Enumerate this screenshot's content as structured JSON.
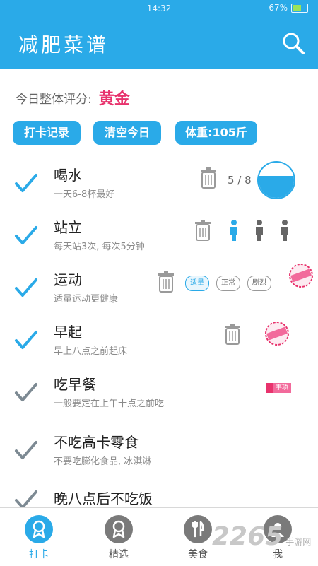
{
  "status_bar": {
    "time": "14:32",
    "battery": "67%",
    "battery_level": 0.67
  },
  "header": {
    "title": "减肥菜谱",
    "search_icon": "search-icon"
  },
  "score": {
    "label": "今日整体评分:",
    "value": "黄金"
  },
  "actions": [
    {
      "label": "打卡记录"
    },
    {
      "label": "清空今日"
    },
    {
      "label": "体重:105斤"
    }
  ],
  "items": [
    {
      "title": "喝水",
      "subtitle": "一天6-8杯最好",
      "count": "5 / 8",
      "water_level": 0.625
    },
    {
      "title": "站立",
      "subtitle": "每天站3次, 每次5分钟",
      "stand_done": 1,
      "stand_total": 3
    },
    {
      "title": "运动",
      "subtitle": "适量运动更健康",
      "levels": [
        "适量",
        "正常",
        "剧烈"
      ]
    },
    {
      "title": "早起",
      "subtitle": "早上八点之前起床"
    },
    {
      "title": "吃早餐",
      "subtitle": "一般要定在上午十点之前吃",
      "tag": "事项"
    },
    {
      "title": "不吃高卡零食",
      "subtitle": "不要吃膨化食品, 冰淇淋"
    },
    {
      "title": "晚八点后不吃饭",
      "subtitle": ""
    }
  ],
  "nav": [
    {
      "label": "打卡"
    },
    {
      "label": "精选"
    },
    {
      "label": "美食"
    },
    {
      "label": "我"
    }
  ],
  "colors": {
    "primary": "#2aaae8",
    "accent": "#e8336d",
    "check_gray": "#7d8a93"
  },
  "watermark": {
    "brand": "2265",
    "site": "手游网"
  }
}
